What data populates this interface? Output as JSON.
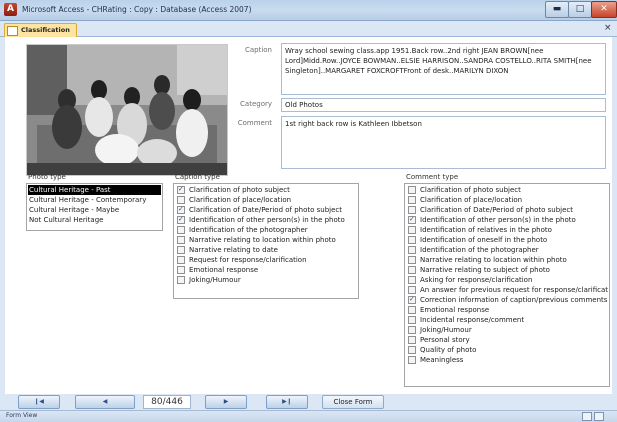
{
  "window": {
    "title": "Microsoft Access - CHRating : Copy : Database (Access 2007)"
  },
  "tab": {
    "label": "Classification"
  },
  "fields": {
    "caption_label": "Caption",
    "caption_value": "Wray school sewing class.app 1951.Back row..2nd right JEAN BROWN[nee Lord]Midd.Row..JOYCE BOWMAN..ELSIE HARRISON..SANDRA COSTELLO..RITA SMITH[nee Singleton]..MARGARET FOXCROFTFront of desk..MARILYN DIXON",
    "category_label": "Category",
    "category_value": "Old Photos",
    "comment_label": "Comment",
    "comment_value": "1st right back row is Kathleen Ibbetson"
  },
  "photo_type": {
    "title": "Photo type",
    "items": [
      {
        "label": "Cultural Heritage - Past",
        "selected": true
      },
      {
        "label": "Cultural Heritage - Contemporary",
        "selected": false
      },
      {
        "label": "Cultural Heritage - Maybe",
        "selected": false
      },
      {
        "label": "Not Cultural Heritage",
        "selected": false
      }
    ]
  },
  "caption_type": {
    "title": "Caption type",
    "items": [
      {
        "label": "Clarification of photo subject",
        "checked": true
      },
      {
        "label": "Clarification of place/location",
        "checked": false
      },
      {
        "label": "Clarification of Date/Period of photo subject",
        "checked": true
      },
      {
        "label": "Identification of other person(s) in the photo",
        "checked": true
      },
      {
        "label": "Identification of the photographer",
        "checked": false
      },
      {
        "label": "Narrative relating to location within photo",
        "checked": false
      },
      {
        "label": "Narrative relating to date",
        "checked": false
      },
      {
        "label": "Request for response/clarification",
        "checked": false
      },
      {
        "label": "Emotional response",
        "checked": false
      },
      {
        "label": "Joking/Humour",
        "checked": false
      }
    ]
  },
  "comment_type": {
    "title": "Comment type",
    "items": [
      {
        "label": "Clarification of photo subject",
        "checked": false
      },
      {
        "label": "Clarification of place/location",
        "checked": false
      },
      {
        "label": "Clarification of Date/Period of photo subject",
        "checked": false
      },
      {
        "label": "Identification of other person(s) in the photo",
        "checked": true
      },
      {
        "label": "Identification of relatives in the photo",
        "checked": false
      },
      {
        "label": "Identification of oneself in the photo",
        "checked": false
      },
      {
        "label": "Identification of the photographer",
        "checked": false
      },
      {
        "label": "Narrative relating to location within photo",
        "checked": false
      },
      {
        "label": "Narrative relating to subject of photo",
        "checked": false
      },
      {
        "label": "Asking for response/clarification",
        "checked": false
      },
      {
        "label": "An answer for previous request for response/clarificat",
        "checked": false
      },
      {
        "label": "Correction information of caption/previous comments",
        "checked": true
      },
      {
        "label": "Emotional response",
        "checked": false
      },
      {
        "label": "Incidental response/comment",
        "checked": false
      },
      {
        "label": "Joking/Humour",
        "checked": false
      },
      {
        "label": "Personal story",
        "checked": false
      },
      {
        "label": "Quality of photo",
        "checked": false
      },
      {
        "label": "Meaningless",
        "checked": false
      }
    ]
  },
  "navigation": {
    "first_icon": "first-record-icon",
    "prev_icon": "previous-record-icon",
    "next_icon": "next-record-icon",
    "last_icon": "last-record-icon",
    "counter": "80/446",
    "close_label": "Close Form"
  },
  "status": {
    "text": "Form View"
  }
}
